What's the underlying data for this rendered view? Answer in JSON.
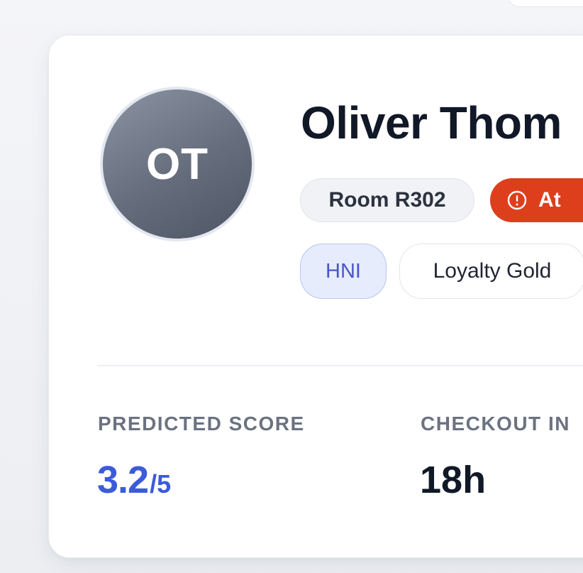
{
  "guest": {
    "initials": "OT",
    "name": "Oliver Thom"
  },
  "badges": {
    "room": "Room R302",
    "risk": "At",
    "risk_color": "#dd3f1c",
    "segment": "HNI",
    "loyalty": "Loyalty Gold"
  },
  "stats": {
    "predicted_score_label": "PREDICTED SCORE",
    "predicted_score_value": "3.2",
    "predicted_score_suffix": "/5",
    "checkout_label": "CHECKOUT IN",
    "checkout_value": "18h"
  },
  "colors": {
    "accent": "#3b5bdb",
    "avatar": "#6b7280"
  },
  "icons": {
    "risk": "alert-circle-icon"
  }
}
